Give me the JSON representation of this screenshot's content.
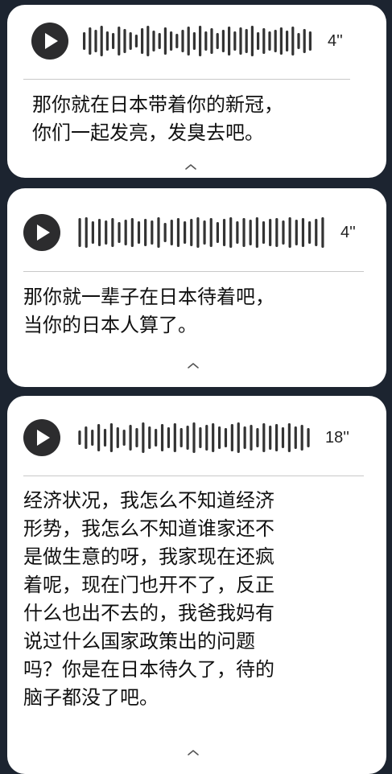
{
  "messages": [
    {
      "duration": "4''",
      "transcript": "那你就在日本带着你的新冠，\n你们一起发亮，发臭去吧。",
      "waveform": [
        0.55,
        0.85,
        0.7,
        0.95,
        0.6,
        0.5,
        0.9,
        0.75,
        0.55,
        0.4,
        0.8,
        0.95,
        0.65,
        0.5,
        0.85,
        0.6,
        0.45,
        0.7,
        0.9,
        0.55,
        0.95,
        0.6,
        0.8,
        0.5,
        0.7,
        0.9,
        0.6,
        0.85,
        0.75,
        0.95,
        0.55,
        0.8,
        0.6,
        0.7,
        0.85,
        0.65,
        0.9,
        0.5,
        0.75,
        0.6
      ]
    },
    {
      "duration": "4''",
      "transcript": "那你就一辈子在日本待着吧，\n当你的日本人算了。",
      "waveform": [
        0.9,
        0.95,
        0.7,
        0.85,
        0.75,
        0.9,
        0.65,
        0.8,
        0.9,
        0.7,
        0.85,
        0.75,
        0.95,
        0.6,
        0.8,
        0.9,
        0.7,
        0.85,
        0.95,
        0.75,
        0.9,
        0.65,
        0.85,
        0.95,
        0.7,
        0.9,
        0.8,
        0.95,
        0.7,
        0.85,
        0.9,
        0.75,
        0.95,
        0.8,
        0.9,
        0.7,
        0.85,
        0.95
      ]
    },
    {
      "duration": "18''",
      "transcript": "经济状况，我怎么不知道经济\n形势，我怎么不知道谁家还不\n是做生意的呀，我家现在还疯\n着呢，现在门也开不了，反正\n什么也出不去的，我爸我妈有\n说过什么国家政策出的问题\n吗？你是在日本待久了，待的\n脑子都没了吧。",
      "waveform": [
        0.45,
        0.7,
        0.5,
        0.85,
        0.55,
        0.9,
        0.65,
        0.5,
        0.8,
        0.6,
        0.95,
        0.7,
        0.55,
        0.85,
        0.65,
        0.9,
        0.6,
        0.75,
        0.95,
        0.65,
        0.8,
        0.9,
        0.7,
        0.6,
        0.85,
        0.95,
        0.7,
        0.8,
        0.6,
        0.9,
        0.75,
        0.85,
        0.65,
        0.9,
        0.7,
        0.8,
        0.6
      ]
    }
  ],
  "colors": {
    "background": "#1c2430",
    "card": "#ffffff",
    "play_button": "#2c2c2e",
    "waveform": "#333333",
    "divider": "#c9c9c9"
  },
  "icons": {
    "play": "play-icon",
    "collapse": "chevron-up-icon"
  }
}
